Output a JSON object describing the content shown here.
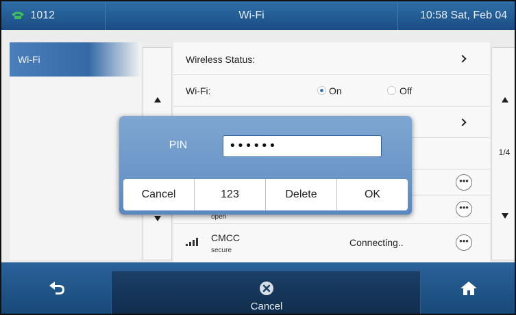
{
  "status_bar": {
    "extension": "1012",
    "title": "Wi-Fi",
    "datetime": "10:58 Sat, Feb 04"
  },
  "left_menu": {
    "items": [
      {
        "label": "Wi-Fi",
        "selected": true
      }
    ]
  },
  "settings": {
    "wireless_status_label": "Wireless Status:",
    "wifi_label": "Wi-Fi:",
    "wifi_on_label": "On",
    "wifi_off_label": "Off",
    "wifi_selected": "On"
  },
  "networks": [
    {
      "ssid": "",
      "security": "",
      "status": ""
    },
    {
      "ssid": "",
      "security": "open",
      "status": ""
    },
    {
      "ssid": "CMCC",
      "security": "secure",
      "status": "Connecting.."
    }
  ],
  "pagination": {
    "indicator": "1/4"
  },
  "dialog": {
    "pin_label": "PIN",
    "pin_value": "••••••",
    "buttons": {
      "cancel": "Cancel",
      "mode": "123",
      "delete": "Delete",
      "ok": "OK"
    }
  },
  "bottom_bar": {
    "cancel_label": "Cancel"
  },
  "colors": {
    "bar_blue": "#1a4c83",
    "dialog_blue": "#6a95c7",
    "selected_blue": "#3a74b8"
  }
}
